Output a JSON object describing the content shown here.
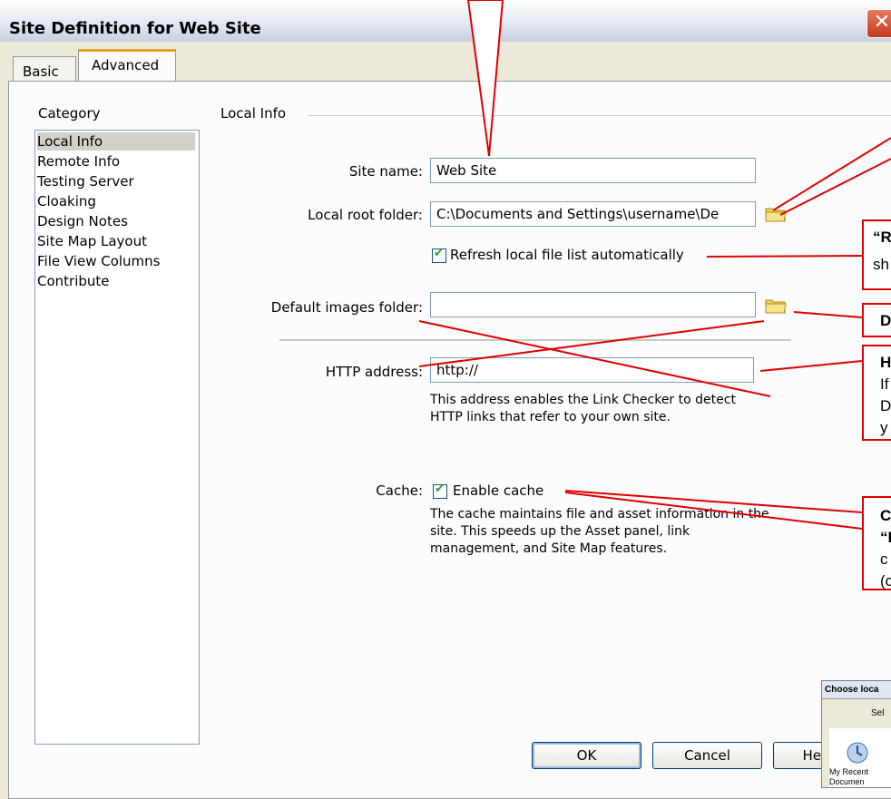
{
  "window": {
    "title": "Site Definition for Web Site",
    "close_glyph": "✕"
  },
  "tabs": {
    "basic": "Basic",
    "advanced": "Advanced"
  },
  "category": {
    "label": "Category",
    "items": [
      "Local Info",
      "Remote Info",
      "Testing Server",
      "Cloaking",
      "Design Notes",
      "Site Map Layout",
      "File View Columns",
      "Contribute"
    ]
  },
  "local_info": {
    "section_title": "Local Info",
    "site_name_label": "Site name:",
    "site_name_value": "Web Site",
    "local_root_label": "Local root folder:",
    "local_root_value": "C:\\Documents and Settings\\username\\De",
    "refresh_label": "Refresh local file list automatically",
    "default_images_label": "Default images folder:",
    "default_images_value": "",
    "http_label": "HTTP address:",
    "http_value": "http://",
    "http_help": "This address enables the Link Checker to detect HTTP links that refer to your own site.",
    "cache_label": "Cache:",
    "cache_checkbox_label": "Enable cache",
    "cache_help": "The cache maintains file and asset information in the site.  This speeds up the Asset panel, link management, and Site Map features."
  },
  "buttons": {
    "ok": "OK",
    "cancel": "Cancel",
    "help": "He"
  },
  "callouts": {
    "refresh_a": "“R",
    "refresh_b": "sh",
    "images": "D",
    "http_a": "H",
    "http_b": "If",
    "http_c": "D",
    "http_d": "y",
    "cache_a": "C",
    "cache_b": "“I",
    "cache_c": "c",
    "cache_d": "(c"
  },
  "thumbnail": {
    "title": "Choose loca",
    "text": "Sel",
    "item": "My Recent",
    "item2": "Documen"
  },
  "colors": {
    "annotation": "#e00000",
    "tab_highlight": "#e6a21a",
    "selection": "#d4d0c8"
  }
}
